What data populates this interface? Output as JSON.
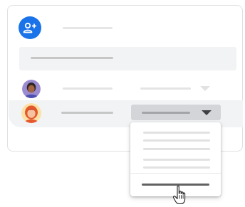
{
  "header": {
    "add_person_icon": "person-add-icon",
    "accent_color": "#1a73e8"
  },
  "people": [
    {
      "avatar": "avatar-person-1",
      "role_select": {
        "expanded": false
      }
    },
    {
      "avatar": "avatar-person-2",
      "role_select": {
        "expanded": true
      }
    }
  ],
  "dropdown": {
    "option_count": 5,
    "hovered_option_index": 4
  },
  "cursor": {
    "icon": "hand-pointer-icon"
  }
}
